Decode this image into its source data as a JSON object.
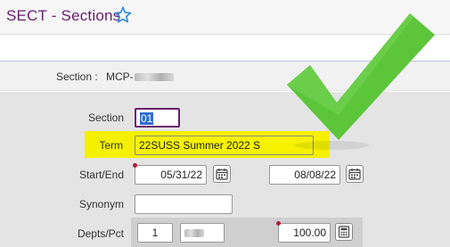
{
  "window": {
    "title": "SECT - Sections"
  },
  "icons": {
    "favorite": "star-outline-icon",
    "calendar": "calendar-icon"
  },
  "section_bar": {
    "label": "Section :",
    "value_prefix": "MCP-"
  },
  "form": {
    "section": {
      "label": "Section",
      "value": "01"
    },
    "term": {
      "label": "Term",
      "value": "22SUSS Summer 2022 S"
    },
    "start_end": {
      "label": "Start/End",
      "start": "05/31/22",
      "end": "08/08/22"
    },
    "synonym": {
      "label": "Synonym",
      "value": ""
    },
    "depts_pct": {
      "label": "Depts/Pct",
      "number": "1",
      "percent": "100.00"
    }
  },
  "colors": {
    "title": "#6a1e6e",
    "accent_blue": "#2f8ad8",
    "highlight": "#f4f000",
    "check": "#5cc53a",
    "required_dot": "#b2203a"
  }
}
